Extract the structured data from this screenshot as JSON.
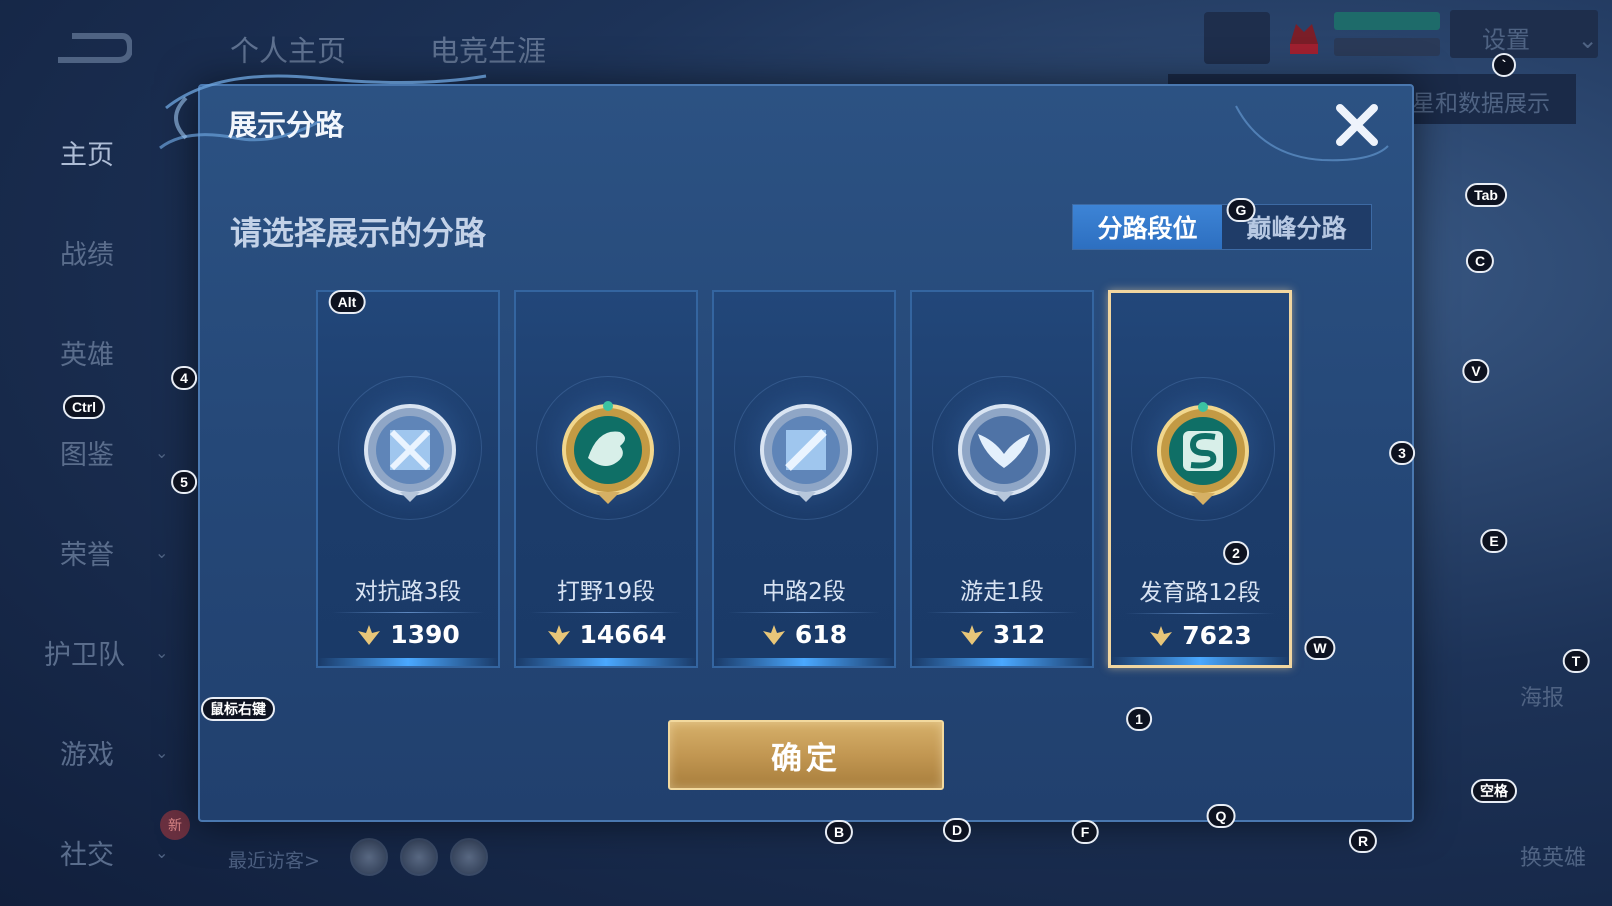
{
  "background": {
    "top_tabs": [
      "个人主页",
      "电竞生涯"
    ],
    "sidebar": [
      {
        "label": "主页",
        "active": true,
        "expandable": false
      },
      {
        "label": "战绩",
        "active": false,
        "expandable": false
      },
      {
        "label": "英雄",
        "active": false,
        "expandable": false
      },
      {
        "label": "图鉴",
        "active": false,
        "expandable": true
      },
      {
        "label": "荣誉",
        "active": false,
        "expandable": true
      },
      {
        "label": "护卫队",
        "active": false,
        "expandable": true
      },
      {
        "label": "游戏",
        "active": false,
        "expandable": true
      },
      {
        "label": "社交",
        "active": false,
        "expandable": true
      }
    ],
    "new_badge": "新",
    "recent_visitors_label": "最近访客>",
    "settings_label": "设置",
    "data_display_label": "星和数据展示",
    "poster_label": "海报",
    "switch_hero_label": "换英雄"
  },
  "modal": {
    "title": "展示分路",
    "subtitle": "请选择展示的分路",
    "tabs": [
      {
        "label": "分路段位",
        "active": true
      },
      {
        "label": "巅峰分路",
        "active": false
      }
    ],
    "cards": [
      {
        "name": "对抗路3段",
        "score": "1390",
        "icon": "clash-lane-icon",
        "badge_style": "silver",
        "selected": false
      },
      {
        "name": "打野19段",
        "score": "14664",
        "icon": "jungle-dragon-icon",
        "badge_style": "gold",
        "selected": false
      },
      {
        "name": "中路2段",
        "score": "618",
        "icon": "mid-lane-icon",
        "badge_style": "silver",
        "selected": false
      },
      {
        "name": "游走1段",
        "score": "312",
        "icon": "roam-wings-icon",
        "badge_style": "silver",
        "selected": false
      },
      {
        "name": "发育路12段",
        "score": "7623",
        "icon": "farm-lane-icon",
        "badge_style": "gold",
        "selected": true
      }
    ],
    "confirm_label": "确定"
  },
  "hotkeys": {
    "alt": "Alt",
    "ctrl": "Ctrl",
    "tab": "Tab",
    "space": "空格",
    "right_click": "鼠标右键",
    "k4": "4",
    "k5": "5",
    "k3": "3",
    "k2": "2",
    "k1": "1",
    "g": "G",
    "c": "C",
    "v": "V",
    "e": "E",
    "w": "W",
    "t": "T",
    "b": "B",
    "d": "D",
    "f": "F",
    "q": "Q",
    "r": "R",
    "backtick": "`"
  },
  "colors": {
    "accent_blue": "#2d6fc0",
    "confirm_gold": "#c29752",
    "selected_border": "#f1d6a0"
  }
}
